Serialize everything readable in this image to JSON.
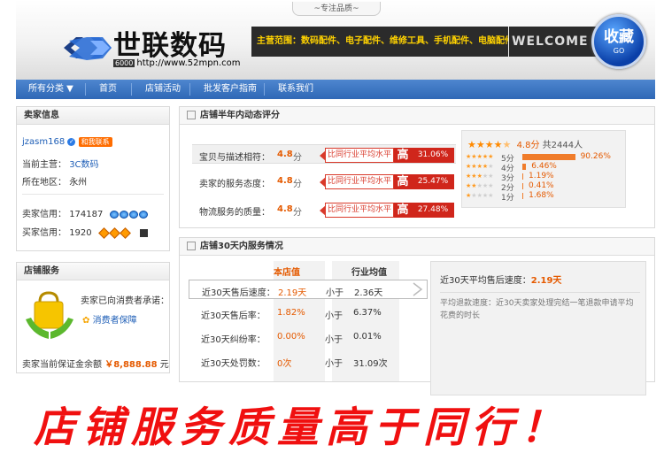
{
  "banner": {
    "slogan": "~专注品质~",
    "brand": "世联数码",
    "url_tag": "6000",
    "url": "http://www.52mpn.com",
    "scope": "主营范围：数码配件、电子配件、维修工具、手机配件、电脑配件…",
    "welcome": "WELCOME",
    "fav_label": "收藏",
    "fav_sub": "GO"
  },
  "nav": {
    "items": [
      "所有分类 ▼",
      "首页",
      "店铺活动",
      "批发客户指南",
      "联系我们"
    ]
  },
  "seller": {
    "title": "卖家信息",
    "name": "jzasm168",
    "contact": "和我联系",
    "main_label": "当前主营：",
    "main_value": "3C数码",
    "location_label": "所在地区：",
    "location_value": "永州",
    "seller_credit_label": "卖家信用：",
    "seller_credit_value": "174187",
    "buyer_credit_label": "买家信用：",
    "buyer_credit_value": "1920"
  },
  "service": {
    "title": "店铺服务",
    "promise": "卖家已向消费者承诺：",
    "guarantee": "消费者保障",
    "deposit_label": "卖家当前保证金余额",
    "deposit_currency": "￥",
    "deposit_value": "8,888.88",
    "deposit_unit": "元"
  },
  "dsr": {
    "title": "店铺半年内动态评分",
    "compare_text": "比同行业平均水平",
    "high": "高",
    "unit": "分",
    "rows": [
      {
        "label": "宝贝与描述相符：",
        "score": "4.8",
        "pct": "31.06%"
      },
      {
        "label": "卖家的服务态度：",
        "score": "4.8",
        "pct": "25.47%"
      },
      {
        "label": "物流服务的质量：",
        "score": "4.8",
        "pct": "27.48%"
      }
    ],
    "overall_score": "4.8分",
    "overall_count": "共2444人",
    "distribution": [
      {
        "label": "5分",
        "value": 90.26,
        "pct": "90.26%"
      },
      {
        "label": "4分",
        "value": 6.46,
        "pct": "6.46%"
      },
      {
        "label": "3分",
        "value": 1.19,
        "pct": "1.19%"
      },
      {
        "label": "2分",
        "value": 0.41,
        "pct": "0.41%"
      },
      {
        "label": "1分",
        "value": 1.68,
        "pct": "1.68%"
      }
    ]
  },
  "svc30": {
    "title": "店铺30天内服务情况",
    "col_shop": "本店值",
    "col_avg": "行业均值",
    "rows": [
      {
        "label": "近30天售后速度：",
        "value": "2.19天",
        "less": "小于",
        "avg": "2.36天"
      },
      {
        "label": "近30天售后率：",
        "value": "1.82%",
        "less": "小于",
        "avg": "6.37%"
      },
      {
        "label": "近30天纠纷率：",
        "value": "0.00%",
        "less": "小于",
        "avg": "0.01%"
      },
      {
        "label": "近30天处罚数：",
        "value": "0次",
        "less": "小于",
        "avg": "31.09次"
      }
    ],
    "info_title": "近30天平均售后速度：",
    "info_value": "2.19天",
    "info_desc": "平均退款速度：近30天卖家处理完结一笔退款申请平均花费的时长"
  },
  "slogan": "店铺服务质量高于同行！",
  "colors": {
    "nav_blue": "#3a74c1",
    "accent_orange": "#e55a00",
    "compare_red": "#d0261b",
    "slogan_red": "#f01010"
  }
}
